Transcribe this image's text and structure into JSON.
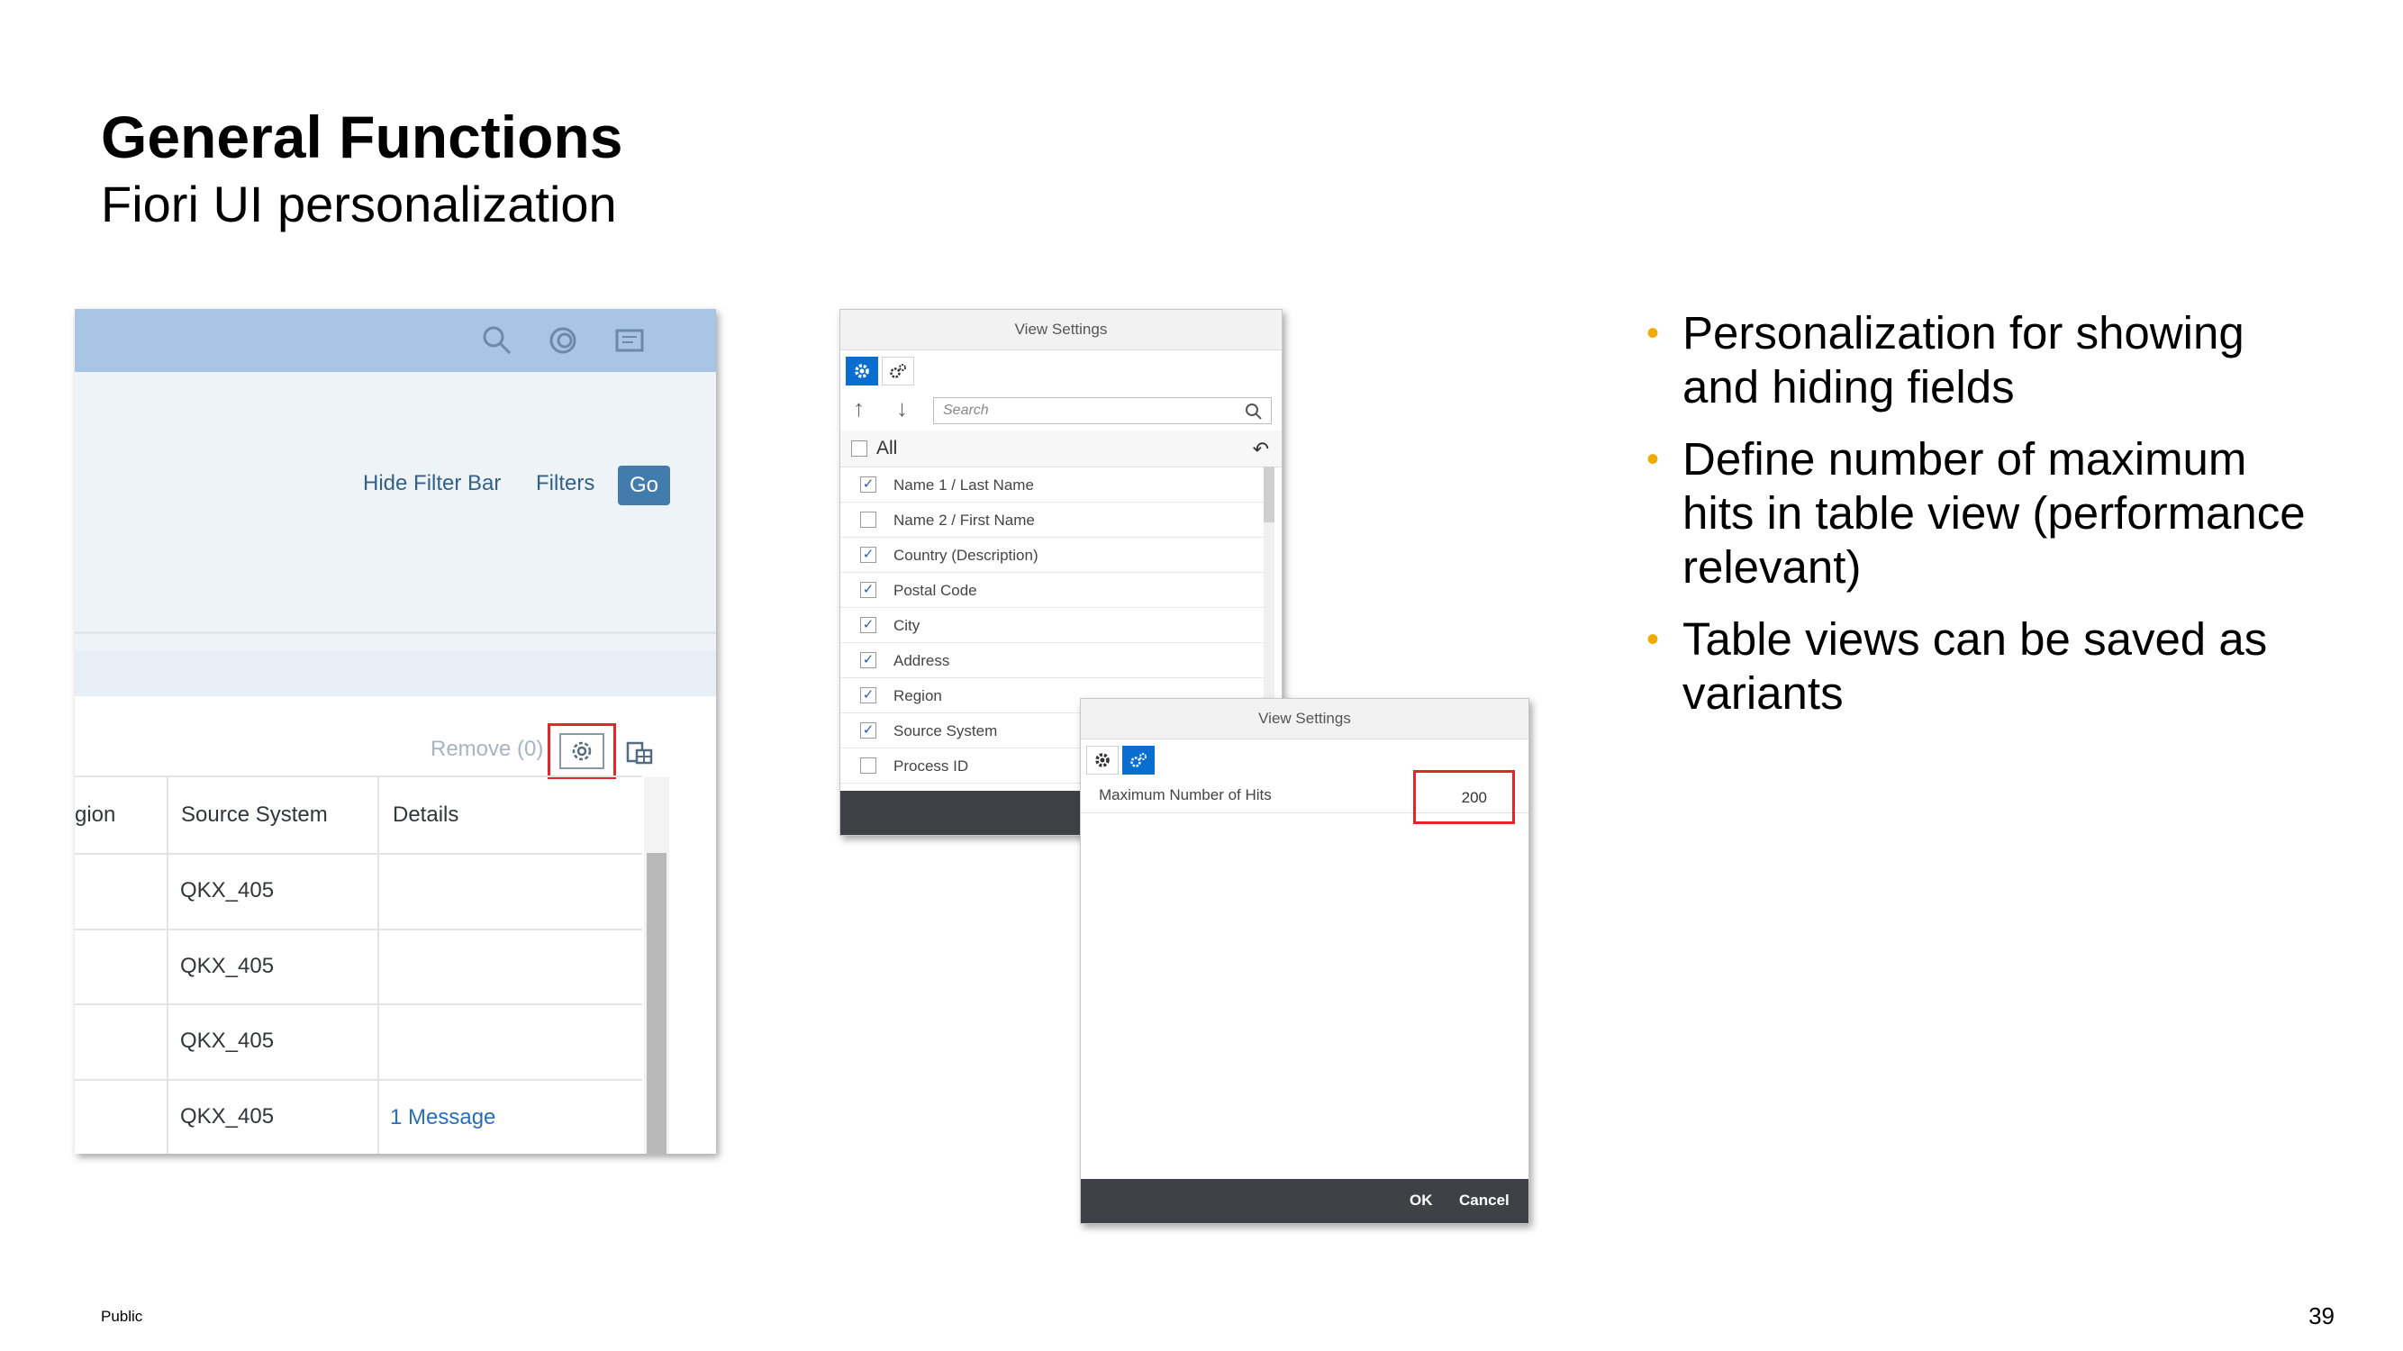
{
  "slide": {
    "title": "General Functions",
    "subtitle": "Fiori UI personalization",
    "footer_label": "Public",
    "page_number": "39"
  },
  "screen1": {
    "shell_icons": [
      "search-icon",
      "copilot-icon",
      "notifications-icon"
    ],
    "hide_filter_bar": "Hide Filter Bar",
    "filters": "Filters",
    "go": "Go",
    "remove": "Remove (0)",
    "columns": [
      "gion",
      "Source System",
      "Details"
    ],
    "rows": [
      {
        "source_system": "QKX_405",
        "details": ""
      },
      {
        "source_system": "QKX_405",
        "details": ""
      },
      {
        "source_system": "QKX_405",
        "details": ""
      },
      {
        "source_system": "QKX_405",
        "details": "1 Message"
      }
    ]
  },
  "view_settings_columns": {
    "title": "View Settings",
    "search_placeholder": "Search",
    "all_label": "All",
    "all_checked": false,
    "items": [
      {
        "label": "Name 1 / Last Name",
        "checked": true
      },
      {
        "label": "Name 2 / First Name",
        "checked": false
      },
      {
        "label": "Country (Description)",
        "checked": true
      },
      {
        "label": "Postal Code",
        "checked": true
      },
      {
        "label": "City",
        "checked": true
      },
      {
        "label": "Address",
        "checked": true
      },
      {
        "label": "Region",
        "checked": true
      },
      {
        "label": "Source System",
        "checked": true
      },
      {
        "label": "Process ID",
        "checked": false
      }
    ]
  },
  "view_settings_hits": {
    "title": "View Settings",
    "max_hits_label": "Maximum Number of Hits",
    "max_hits_value": "200",
    "ok": "OK",
    "cancel": "Cancel"
  },
  "bullets": [
    "Personalization for showing and hiding fields",
    "Define number of maximum hits in table view (performance relevant)",
    "Table views can be saved as variants"
  ],
  "colors": {
    "bullet_accent": "#f0ab00",
    "highlight_red": "#e0272c",
    "shell_blue": "#a9c5e5",
    "go_button": "#427cac",
    "selected_tab": "#0a6ed1",
    "dialog_footer": "#3e4247"
  }
}
